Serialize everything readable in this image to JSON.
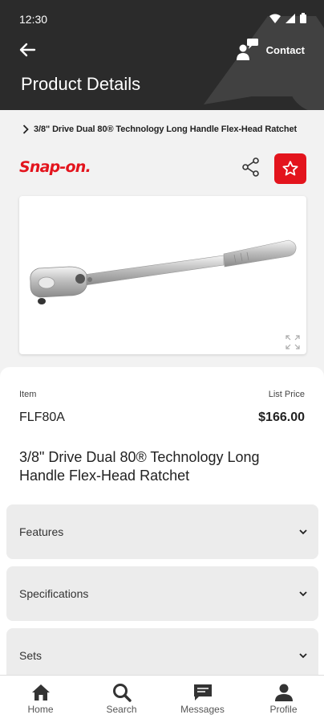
{
  "status_bar": {
    "time": "12:30"
  },
  "header": {
    "title": "Product Details",
    "contact_label": "Contact"
  },
  "breadcrumb": {
    "text": "3/8\" Drive Dual 80® Technology Long Handle Flex-Head Ratchet"
  },
  "brand": {
    "logo_text": "Snap-on."
  },
  "product": {
    "item_label": "Item",
    "item_value": "FLF80A",
    "price_label": "List Price",
    "price_value": "$166.00",
    "name": "3/8\" Drive Dual 80® Technology Long Handle Flex-Head Ratchet"
  },
  "sections": [
    {
      "label": "Features"
    },
    {
      "label": "Specifications"
    },
    {
      "label": "Sets"
    }
  ],
  "nav": [
    {
      "label": "Home",
      "icon": "home-icon"
    },
    {
      "label": "Search",
      "icon": "search-icon"
    },
    {
      "label": "Messages",
      "icon": "messages-icon"
    },
    {
      "label": "Profile",
      "icon": "profile-icon"
    }
  ],
  "colors": {
    "header_bg": "#2b2b2b",
    "brand_red": "#e3141d",
    "page_bg": "#f2f2f2"
  }
}
